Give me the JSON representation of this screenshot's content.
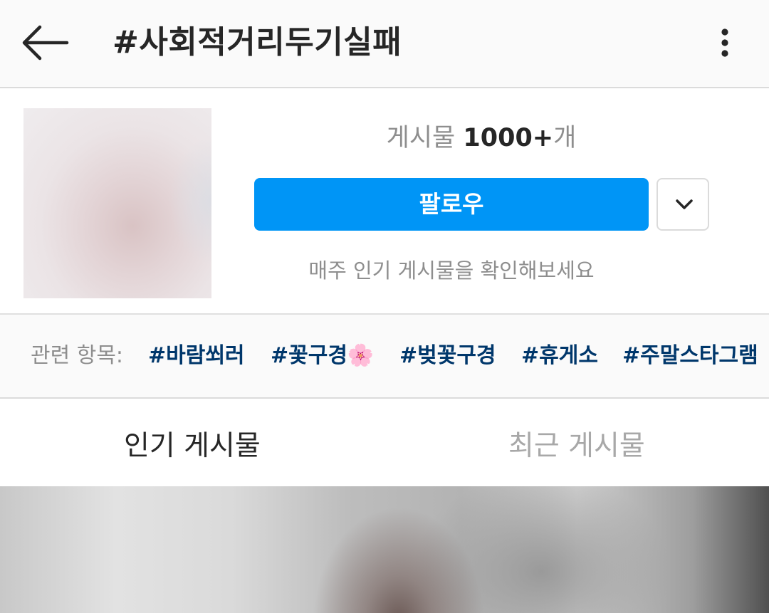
{
  "header": {
    "title": "#사회적거리두기실패",
    "back_icon": "arrow-left-icon",
    "more_icon": "more-vertical-icon"
  },
  "profile": {
    "post_count_prefix": "게시물 ",
    "post_count_value": "1000+",
    "post_count_suffix": "개",
    "follow_label": "팔로우",
    "dropdown_icon": "chevron-down-icon",
    "hint": "매주 인기 게시물을 확인해보세요",
    "accent_color": "#0095f6"
  },
  "related": {
    "label": "관련 항목:",
    "tags": [
      "#바람쐬러",
      "#꽃구경🌸",
      "#벚꽃구경",
      "#휴게소",
      "#주말스타그램"
    ],
    "tag_color": "#00376b"
  },
  "tabs": [
    {
      "label": "인기 게시물",
      "active": true
    },
    {
      "label": "최근 게시물",
      "active": false
    }
  ]
}
